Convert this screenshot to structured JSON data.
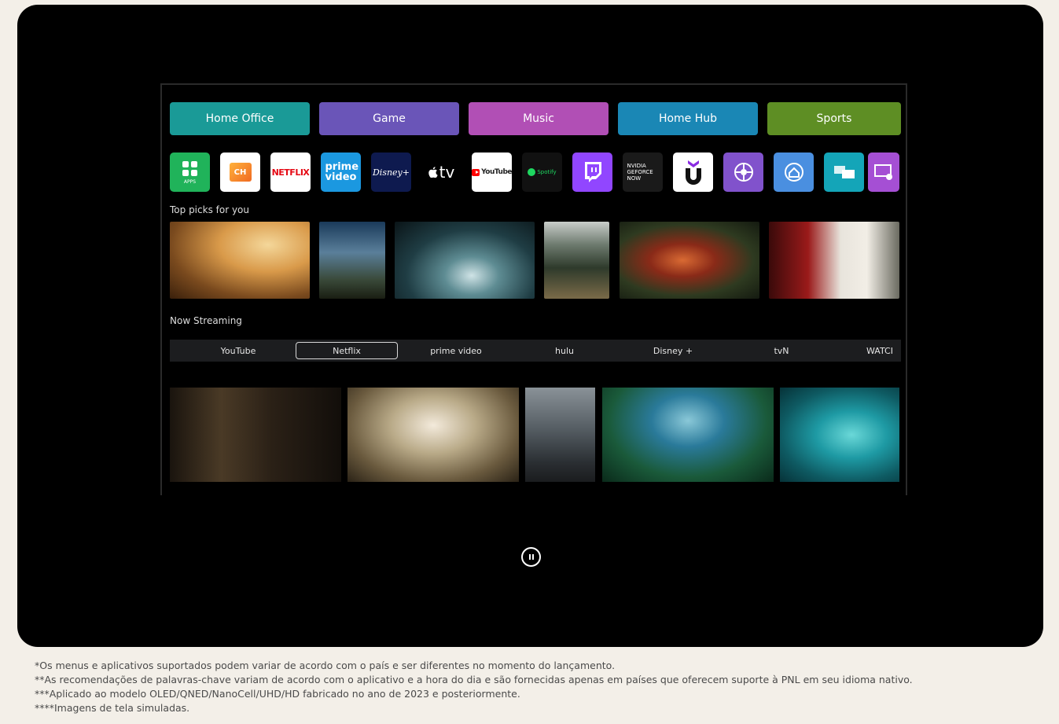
{
  "categories": [
    {
      "label": "Home Office",
      "color": "#1a9a97"
    },
    {
      "label": "Game",
      "color": "#6a55b8"
    },
    {
      "label": "Music",
      "color": "#b14fb5"
    },
    {
      "label": "Home Hub",
      "color": "#1a87b5"
    },
    {
      "label": "Sports",
      "color": "#5e8e24"
    }
  ],
  "apps": [
    {
      "name": "apps-icon",
      "text": "APPS"
    },
    {
      "name": "channels-icon",
      "text": "CH"
    },
    {
      "name": "netflix-icon",
      "text": "NETFLIX"
    },
    {
      "name": "prime-video-icon",
      "text": "prime video"
    },
    {
      "name": "disney-plus-icon",
      "text": "Disney+"
    },
    {
      "name": "apple-tv-icon",
      "text": "tv"
    },
    {
      "name": "youtube-icon",
      "text": "YouTube"
    },
    {
      "name": "spotify-icon",
      "text": "Spotify"
    },
    {
      "name": "twitch-icon",
      "text": ""
    },
    {
      "name": "geforce-now-icon",
      "text": "NVIDIA GEFORCE NOW"
    },
    {
      "name": "utomik-icon",
      "text": ""
    },
    {
      "name": "sports-hub-icon",
      "text": ""
    },
    {
      "name": "home-hub-icon",
      "text": ""
    },
    {
      "name": "multi-view-icon",
      "text": ""
    },
    {
      "name": "music-screen-icon",
      "text": ""
    }
  ],
  "top_picks_label": "Top picks for you",
  "now_streaming_label": "Now Streaming",
  "tabs": [
    "YouTube",
    "Netflix",
    "prime video",
    "hulu",
    "Disney +",
    "tvN",
    "WATCI"
  ],
  "active_tab": "Netflix",
  "footnotes": [
    "*Os menus e aplicativos suportados podem variar de acordo com o país e ser diferentes no momento do lançamento.",
    "**As recomendações de palavras-chave variam de acordo com o aplicativo e a hora do dia e são fornecidas apenas em países que oferecem suporte à PNL em seu idioma nativo.",
    "***Aplicado ao modelo OLED/QNED/NanoCell/UHD/HD fabricado no ano de 2023 e posteriormente.",
    "****Imagens de tela simuladas."
  ]
}
